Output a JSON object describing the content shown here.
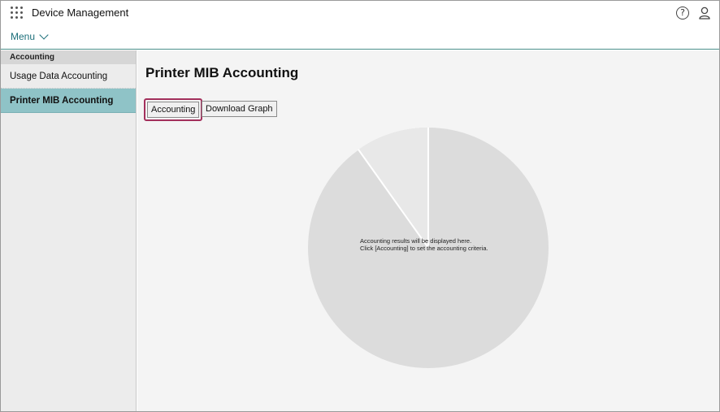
{
  "header": {
    "title": "Device Management",
    "menu_label": "Menu",
    "help_icon": "question-circle-icon",
    "user_icon": "user-icon",
    "apps_icon": "apps-grid-icon"
  },
  "sidebar": {
    "section_title": "Accounting",
    "items": [
      {
        "label": "Usage Data Accounting",
        "active": false
      },
      {
        "label": "Printer MIB Accounting",
        "active": true
      }
    ]
  },
  "main": {
    "page_title": "Printer MIB Accounting",
    "buttons": {
      "accounting": "Accounting",
      "download_graph": "Download Graph"
    },
    "message_line1": "Accounting results will be displayed here.",
    "message_line2": "Click [Accounting] to set the accounting criteria."
  },
  "colors": {
    "accent": "#1c6f7a",
    "sidebar_active": "#8fc3c7",
    "focus_border": "#a3305c",
    "pie_main": "#dcdcdc",
    "pie_slice": "#e8e8e8"
  }
}
